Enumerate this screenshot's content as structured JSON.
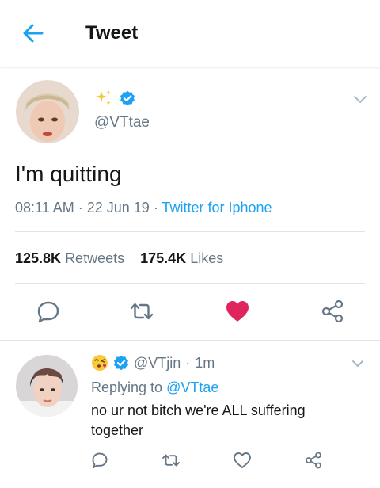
{
  "header": {
    "title": "Tweet",
    "back_icon": "arrow-left-icon"
  },
  "tweet": {
    "handle": "@VTtae",
    "text": "I'm quitting",
    "time": "08:11 AM",
    "date": "22 Jun 19",
    "source": "Twitter for Iphone",
    "retweets_count": "125.8K",
    "retweets_label": "Retweets",
    "likes_count": "175.4K",
    "likes_label": "Likes",
    "liked": true,
    "name_icon": "sparkles-icon"
  },
  "reply": {
    "handle": "@VTjin",
    "age": "1m",
    "replying_prefix": "Replying to",
    "replying_to": "@VTtae",
    "text": "no ur not bitch we're ALL suffering together",
    "name_icon": "kissing-face-emoji-icon"
  },
  "colors": {
    "accent": "#1da1f2",
    "like": "#e0245e",
    "muted": "#657786",
    "text": "#14171a"
  }
}
